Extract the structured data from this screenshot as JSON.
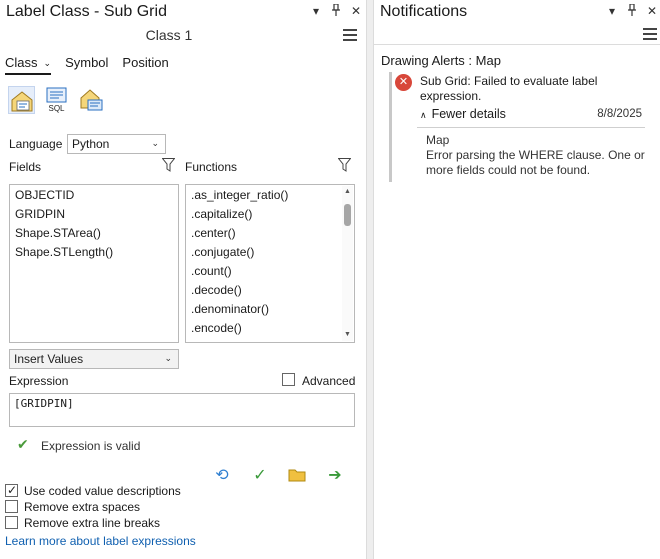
{
  "left_pane": {
    "title": "Label Class - Sub Grid",
    "class_name": "Class 1",
    "tabs": [
      {
        "label": "Class",
        "active": true
      },
      {
        "label": "Symbol",
        "active": false
      },
      {
        "label": "Position",
        "active": false
      }
    ],
    "mode_icons": [
      "label-class-icon",
      "sql-query-icon",
      "label-placement-icon"
    ],
    "sql_icon_text": "SQL",
    "language_label": "Language",
    "language_value": "Python",
    "fields_label": "Fields",
    "functions_label": "Functions",
    "fields": [
      "OBJECTID",
      "GRIDPIN",
      "Shape.STArea()",
      "Shape.STLength()"
    ],
    "functions": [
      ".as_integer_ratio()",
      ".capitalize()",
      ".center()",
      ".conjugate()",
      ".count()",
      ".decode()",
      ".denominator()",
      ".encode()"
    ],
    "insert_values": "Insert Values",
    "expression_label": "Expression",
    "advanced_label": "Advanced",
    "expression_value": "[GRIDPIN]",
    "validity_text": "Expression is valid",
    "options": [
      {
        "label": "Use coded value descriptions",
        "checked": true
      },
      {
        "label": "Remove extra spaces",
        "checked": false
      },
      {
        "label": "Remove extra line breaks",
        "checked": false
      }
    ],
    "learn_more_link": "Learn more about label expressions"
  },
  "right_pane": {
    "title": "Notifications",
    "group_title": "Drawing Alerts : Map",
    "alert_message": "Sub Grid: Failed to evaluate label expression.",
    "details_toggle": "Fewer details",
    "date": "8/8/2025",
    "detail_source": "Map",
    "detail_message": "Error parsing the WHERE clause. One or more fields could not be found."
  },
  "colors": {
    "error": "#d8473a",
    "valid": "#4a9a3b",
    "link": "#1060b0",
    "undo": "#2f7fd0",
    "folder": "#e0b020",
    "apply": "#3a9a3a"
  }
}
